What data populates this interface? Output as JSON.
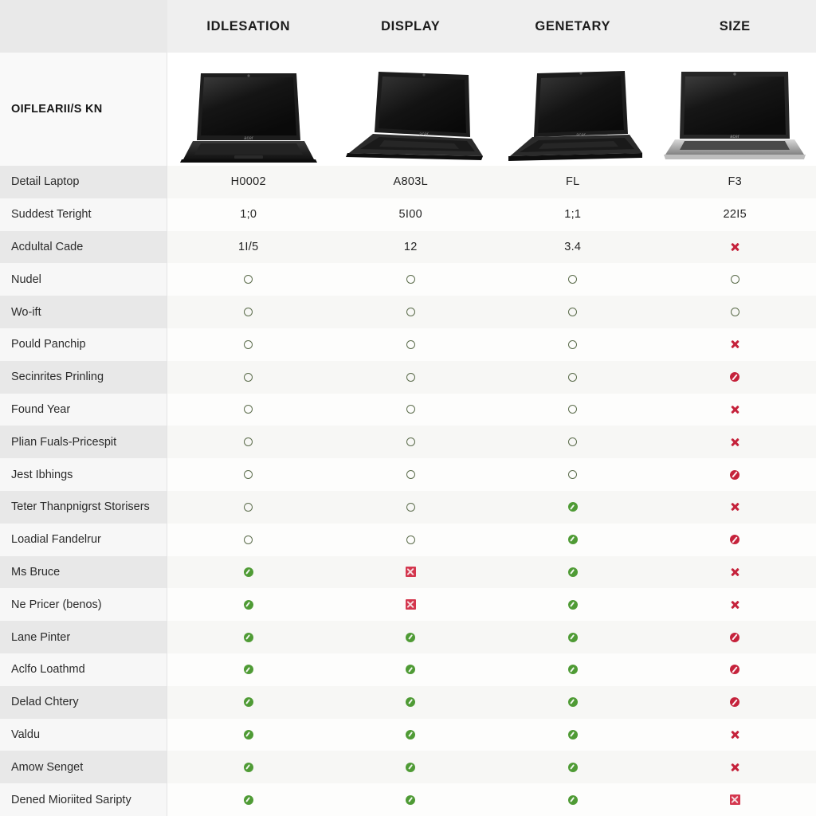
{
  "table": {
    "corner_label": "OIFLEARII/S KN",
    "columns": [
      {
        "header": "IDLESATION",
        "product_image": "laptop-front-black"
      },
      {
        "header": "DISPLAY",
        "product_image": "laptop-angled-black"
      },
      {
        "header": "GENETARY",
        "product_image": "laptop-angled-black"
      },
      {
        "header": "SIZE",
        "product_image": "laptop-front-silver"
      }
    ],
    "rows": [
      {
        "label": "Detail Laptop",
        "values": [
          "H0002",
          "A803L",
          "FL",
          "F3"
        ]
      },
      {
        "label": "Suddest Teright",
        "values": [
          "1;0",
          "5I00",
          "1;1",
          "22I5"
        ]
      },
      {
        "label": "Acdultal Cade",
        "values": [
          "1I/5",
          "12",
          "3.4",
          "x-mark"
        ]
      },
      {
        "label": "Nudel",
        "values": [
          "ring",
          "ring",
          "ring",
          "ring"
        ]
      },
      {
        "label": "Wo-ift",
        "values": [
          "ring",
          "ring",
          "ring",
          "ring"
        ]
      },
      {
        "label": "Pould Panchip",
        "values": [
          "ring",
          "ring",
          "ring",
          "x-mark"
        ]
      },
      {
        "label": "Secinrites Prinling",
        "values": [
          "ring",
          "ring",
          "ring",
          "disc-x"
        ]
      },
      {
        "label": "Found Year",
        "values": [
          "ring",
          "ring",
          "ring",
          "x-mark"
        ]
      },
      {
        "label": "Plian Fuals-Pricespit",
        "values": [
          "ring",
          "ring",
          "ring",
          "x-mark"
        ]
      },
      {
        "label": "Jest Ibhings",
        "values": [
          "ring",
          "ring",
          "ring",
          "disc-x"
        ]
      },
      {
        "label": "Teter Thanpnigrst Storisers",
        "values": [
          "ring",
          "ring",
          "disc-check",
          "x-mark"
        ]
      },
      {
        "label": "Loadial Fandelrur",
        "values": [
          "ring",
          "ring",
          "disc-check",
          "disc-x"
        ]
      },
      {
        "label": "Ms Bruce",
        "values": [
          "disc-check",
          "sq-x",
          "disc-check",
          "x-mark"
        ]
      },
      {
        "label": "Ne Pricer (benos)",
        "values": [
          "disc-check",
          "sq-x",
          "disc-check",
          "x-mark"
        ]
      },
      {
        "label": "Lane Pinter",
        "values": [
          "disc-check",
          "disc-check",
          "disc-check",
          "disc-x"
        ]
      },
      {
        "label": "Aclfo Loathmd",
        "values": [
          "disc-check",
          "disc-check",
          "disc-check",
          "disc-x"
        ]
      },
      {
        "label": "Delad Chtery",
        "values": [
          "disc-check",
          "disc-check",
          "disc-check",
          "disc-x"
        ]
      },
      {
        "label": "Valdu",
        "values": [
          "disc-check",
          "disc-check",
          "disc-check",
          "x-mark"
        ]
      },
      {
        "label": "Amow Senget",
        "values": [
          "disc-check",
          "disc-check",
          "disc-check",
          "x-mark"
        ]
      },
      {
        "label": "Dened Mioriited Saripty",
        "values": [
          "disc-check",
          "disc-check",
          "disc-check",
          "sq-x"
        ]
      }
    ]
  },
  "colors": {
    "header_bg": "#efefef",
    "rowhead_stripe_dark": "#e8e8e8",
    "rowhead_stripe_light": "#f7f7f7",
    "check_green": "#4f9b35",
    "ring_green": "#5a6b4a",
    "cross_red": "#c5223b",
    "square_red": "#d4374e"
  },
  "icon_names": {
    "ring": "empty-circle-icon",
    "disc-check": "green-check-circle-icon",
    "x-mark": "red-cross-icon",
    "disc-x": "red-circle-slash-icon",
    "sq-x": "red-square-cross-icon"
  }
}
